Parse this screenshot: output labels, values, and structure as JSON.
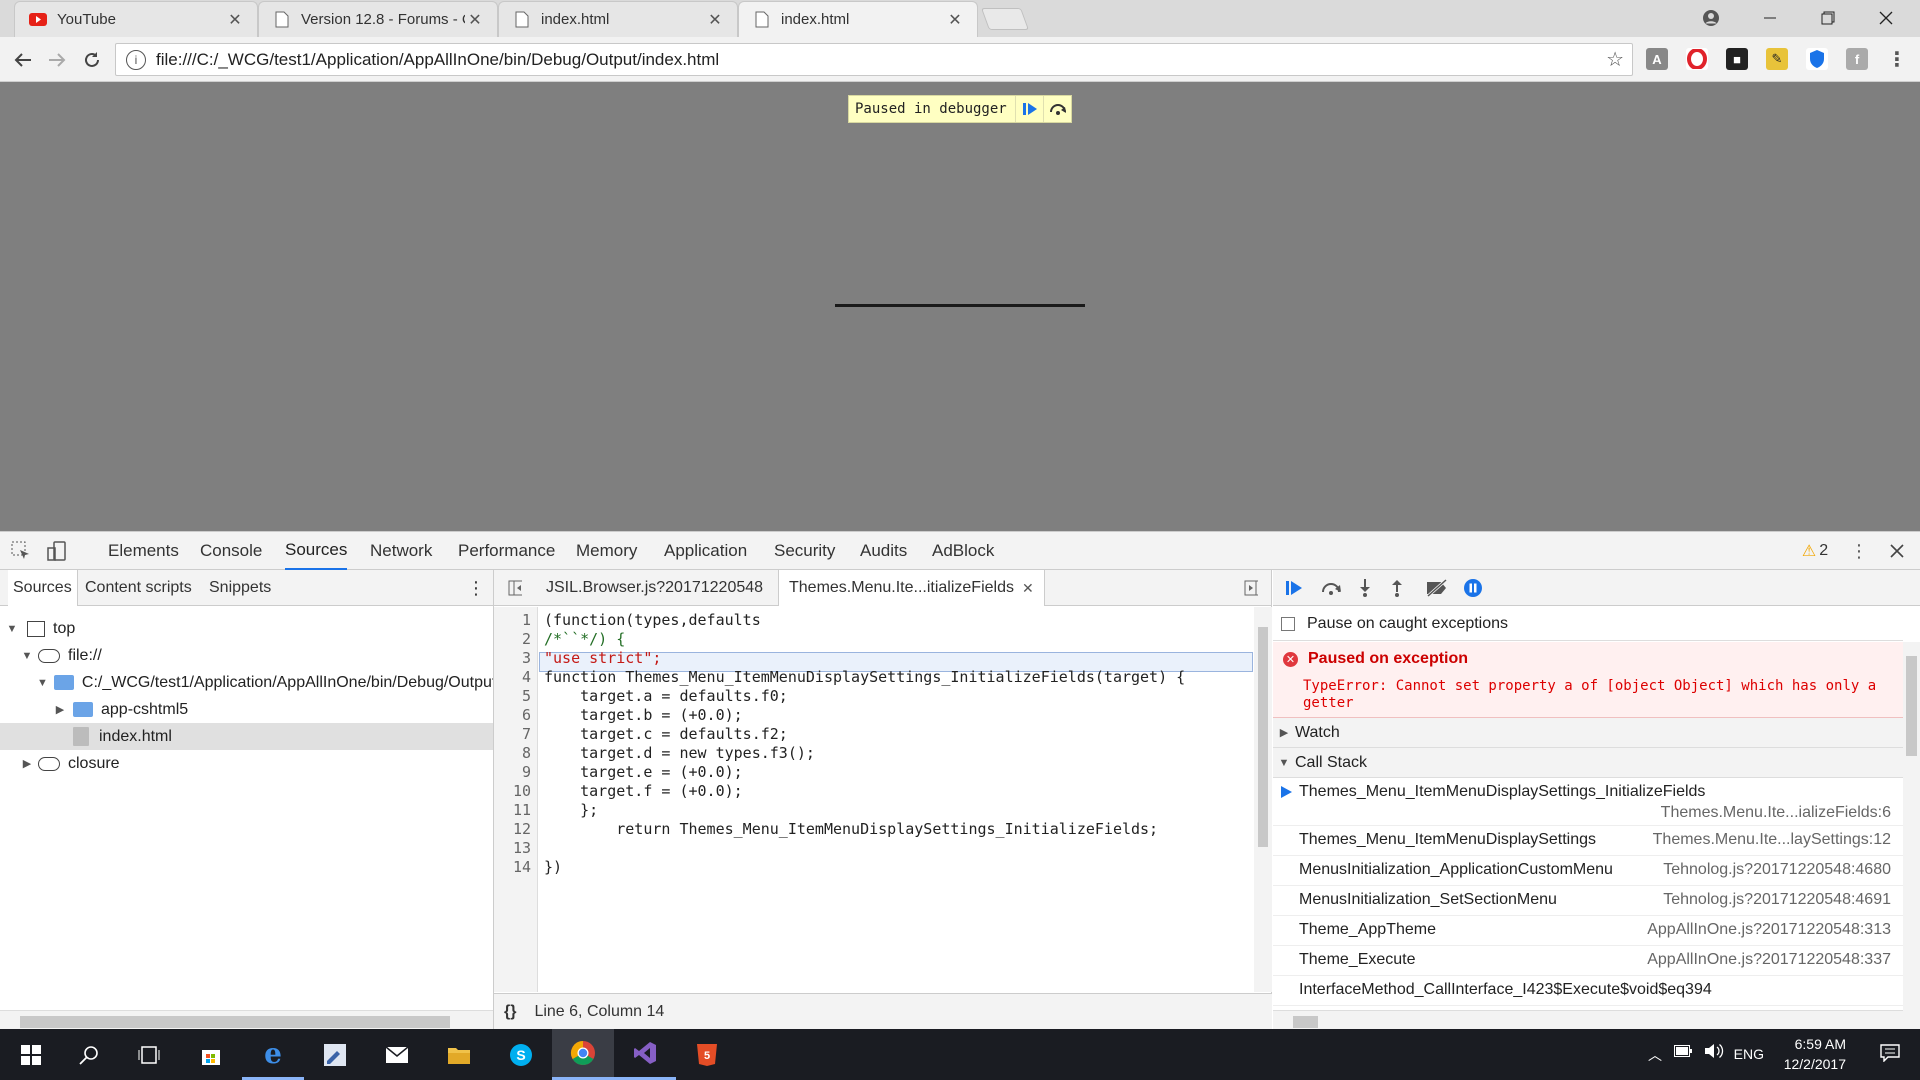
{
  "browser": {
    "tabs": [
      {
        "title": "YouTube",
        "icon": "youtube-icon"
      },
      {
        "title": "Version 12.8 - Forums - C",
        "icon": "page-icon"
      },
      {
        "title": "index.html",
        "icon": "page-icon"
      },
      {
        "title": "index.html",
        "icon": "page-icon",
        "active": true
      }
    ],
    "close_glyph": "✕",
    "url": "file:///C:/_WCG/test1/Application/AppAllInOne/bin/Debug/Output/index.html"
  },
  "page": {
    "paused_text": "Paused in debugger"
  },
  "devtools": {
    "tabs": [
      "Elements",
      "Console",
      "Sources",
      "Network",
      "Performance",
      "Memory",
      "Application",
      "Security",
      "Audits",
      "AdBlock"
    ],
    "active_tab": "Sources",
    "warning_count": "2",
    "navigator": {
      "tabs": [
        "Sources",
        "Content scripts",
        "Snippets"
      ],
      "tree": [
        {
          "label": "top",
          "kind": "frame",
          "expanded": true
        },
        {
          "label": "file://",
          "kind": "cloud",
          "expanded": true
        },
        {
          "label": "C:/_WCG/test1/Application/AppAllInOne/bin/Debug/Output",
          "kind": "folder",
          "expanded": true
        },
        {
          "label": "app-cshtml5",
          "kind": "folder",
          "expanded": false
        },
        {
          "label": "index.html",
          "kind": "file",
          "selected": true
        },
        {
          "label": "closure",
          "kind": "cloud",
          "expanded": false
        }
      ]
    },
    "editor": {
      "tabs": [
        "JSIL.Browser.js?20171220548",
        "Themes.Menu.Ite...itializeFields"
      ],
      "status": "Line 6, Column 14",
      "format_glyph": "{}",
      "line_numbers": [
        "1",
        "2",
        "3",
        "4",
        "5",
        "6",
        "7",
        "8",
        "9",
        "10",
        "11",
        "12",
        "13",
        "14"
      ],
      "lines": [
        "(function(types,defaults",
        "/*``*/) {",
        "\"use strict\";",
        "function Themes_Menu_ItemMenuDisplaySettings_InitializeFields(target) {",
        "    target.a = defaults.f0;",
        "    target.b = (+0.0);",
        "    target.c = defaults.f2;",
        "    target.d = new types.f3();",
        "    target.e = (+0.0);",
        "    target.f = (+0.0);",
        "    };",
        "        return Themes_Menu_ItemMenuDisplaySettings_InitializeFields;",
        "",
        "})"
      ]
    },
    "debugger": {
      "pause_on_caught_label": "Pause on caught exceptions",
      "exception_title": "Paused on exception",
      "exception_message": "TypeError: Cannot set property a of [object Object] which has only a getter",
      "watch_label": "Watch",
      "call_stack_label": "Call Stack",
      "call_stack": [
        {
          "fn": "Themes_Menu_ItemMenuDisplaySettings_InitializeFields",
          "loc": "Themes.Menu.Ite...ializeFields:6",
          "current": true
        },
        {
          "fn": "Themes_Menu_ItemMenuDisplaySettings",
          "loc": "Themes.Menu.Ite...laySettings:12"
        },
        {
          "fn": "MenusInitialization_ApplicationCustomMenu",
          "loc": "Tehnolog.js?20171220548:4680"
        },
        {
          "fn": "MenusInitialization_SetSectionMenu",
          "loc": "Tehnolog.js?20171220548:4691"
        },
        {
          "fn": "Theme_AppTheme",
          "loc": "AppAllInOne.js?20171220548:313"
        },
        {
          "fn": "Theme_Execute",
          "loc": "AppAllInOne.js?20171220548:337"
        },
        {
          "fn": "InterfaceMethod_CallInterface_I423$Execute$void$eq394",
          "loc": ""
        }
      ]
    }
  },
  "taskbar": {
    "lang": "ENG",
    "time": "6:59 AM",
    "date": "12/2/2017"
  },
  "colors": {
    "page_bg": "#7f7f7f",
    "paused_bg": "#ffffc2",
    "active_tab_accent": "#1a73e8",
    "exception_red": "#cc0000"
  }
}
